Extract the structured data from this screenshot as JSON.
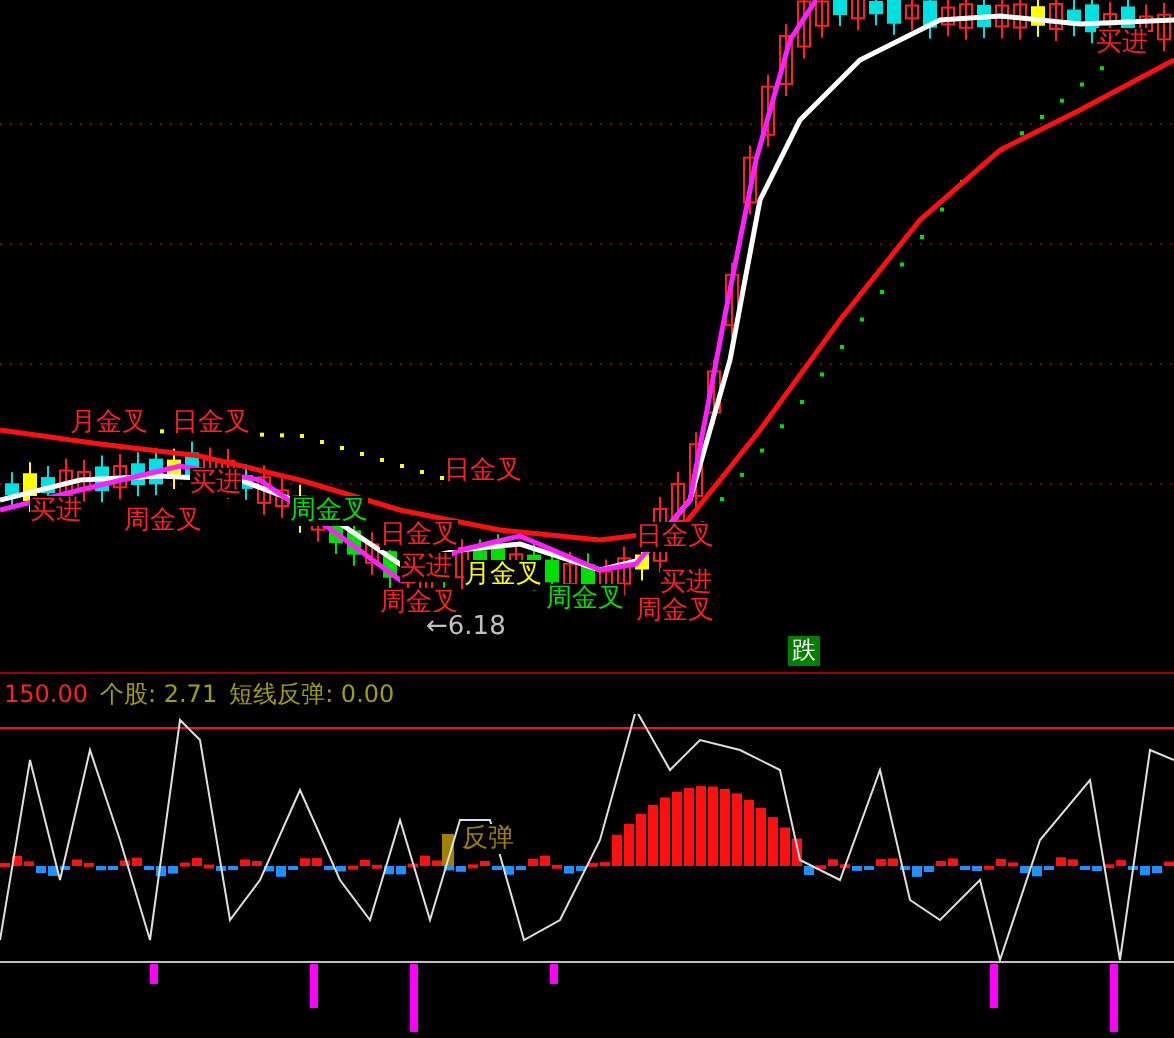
{
  "chart_labels": [
    {
      "text": "买进",
      "color": "#ff2020"
    },
    {
      "text": "月金叉",
      "color": "#ff2020"
    },
    {
      "text": "日金叉",
      "color": "#ff2020"
    },
    {
      "text": "买进",
      "color": "#ff2020"
    },
    {
      "text": "周金叉",
      "color": "#ff2020"
    },
    {
      "text": "买进",
      "color": "#ff2020"
    },
    {
      "text": "周金叉",
      "color": "#00e000"
    },
    {
      "text": "日金叉",
      "color": "#ff2020"
    },
    {
      "text": "日金叉",
      "color": "#ff2020"
    },
    {
      "text": "日金叉",
      "color": "#ff2020"
    },
    {
      "text": "买进",
      "color": "#ff2020"
    },
    {
      "text": "月金叉",
      "color": "#ffff00"
    },
    {
      "text": "买进",
      "color": "#ff2020"
    },
    {
      "text": "周金叉",
      "color": "#ff2020"
    },
    {
      "text": "←6.18",
      "color": "#c0c0c0"
    },
    {
      "text": "周金叉",
      "color": "#00e000"
    },
    {
      "text": "周金叉",
      "color": "#ff2020"
    }
  ],
  "signal_badge": "跌",
  "status_bar": {
    "value": "150.00",
    "stock": "个股: 2.71",
    "rebound": "短线反弹: 0.00"
  },
  "indicator_label": "反弹"
}
